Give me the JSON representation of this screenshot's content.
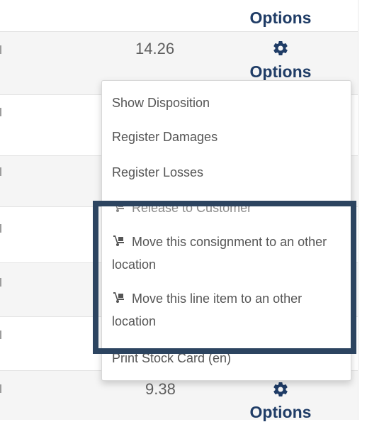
{
  "rows": [
    {
      "value": "",
      "options_label": "Options"
    },
    {
      "value": "14.26",
      "options_label": "Options"
    },
    {
      "value": "9.38",
      "options_label": "Options"
    }
  ],
  "menu": {
    "items": [
      {
        "label": "Show Disposition"
      },
      {
        "label": "Register Damages"
      },
      {
        "label": "Register Losses"
      },
      {
        "label": "Release to Customer",
        "icon": "hand-truck-icon"
      },
      {
        "label": "Move this consignment to an other location",
        "icon": "hand-truck-icon"
      },
      {
        "label": "Move this line item to an other location",
        "icon": "hand-truck-icon"
      },
      {
        "label": "Print Stock Card (en)"
      }
    ]
  },
  "colors": {
    "options_text": "#1f3c66",
    "highlight_border": "#2c4460",
    "row_alt_bg": "#f5f5f5"
  }
}
